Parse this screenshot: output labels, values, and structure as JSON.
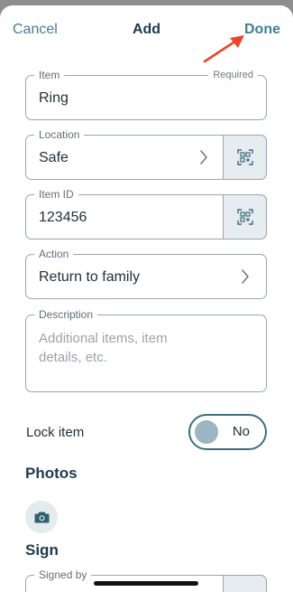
{
  "navbar": {
    "cancel_label": "Cancel",
    "title": "Add",
    "done_label": "Done"
  },
  "fields": {
    "item": {
      "label": "Item",
      "required_label": "Required",
      "value": "Ring"
    },
    "location": {
      "label": "Location",
      "value": "Safe"
    },
    "item_id": {
      "label": "Item ID",
      "value": "123456"
    },
    "action": {
      "label": "Action",
      "value": "Return to family"
    },
    "description": {
      "label": "Description",
      "placeholder": "Additional items, item details, etc."
    },
    "signed_by": {
      "label": "Signed by"
    }
  },
  "lock": {
    "label": "Lock item",
    "toggle_text": "No",
    "enabled": false
  },
  "sections": {
    "photos": "Photos",
    "sign": "Sign"
  },
  "icons": {
    "scan": "qr-scan-icon",
    "camera": "camera-icon",
    "chevron": "chevron-right-icon"
  },
  "colors": {
    "accent": "#3e7f90",
    "annotation_arrow": "#e8452c"
  }
}
